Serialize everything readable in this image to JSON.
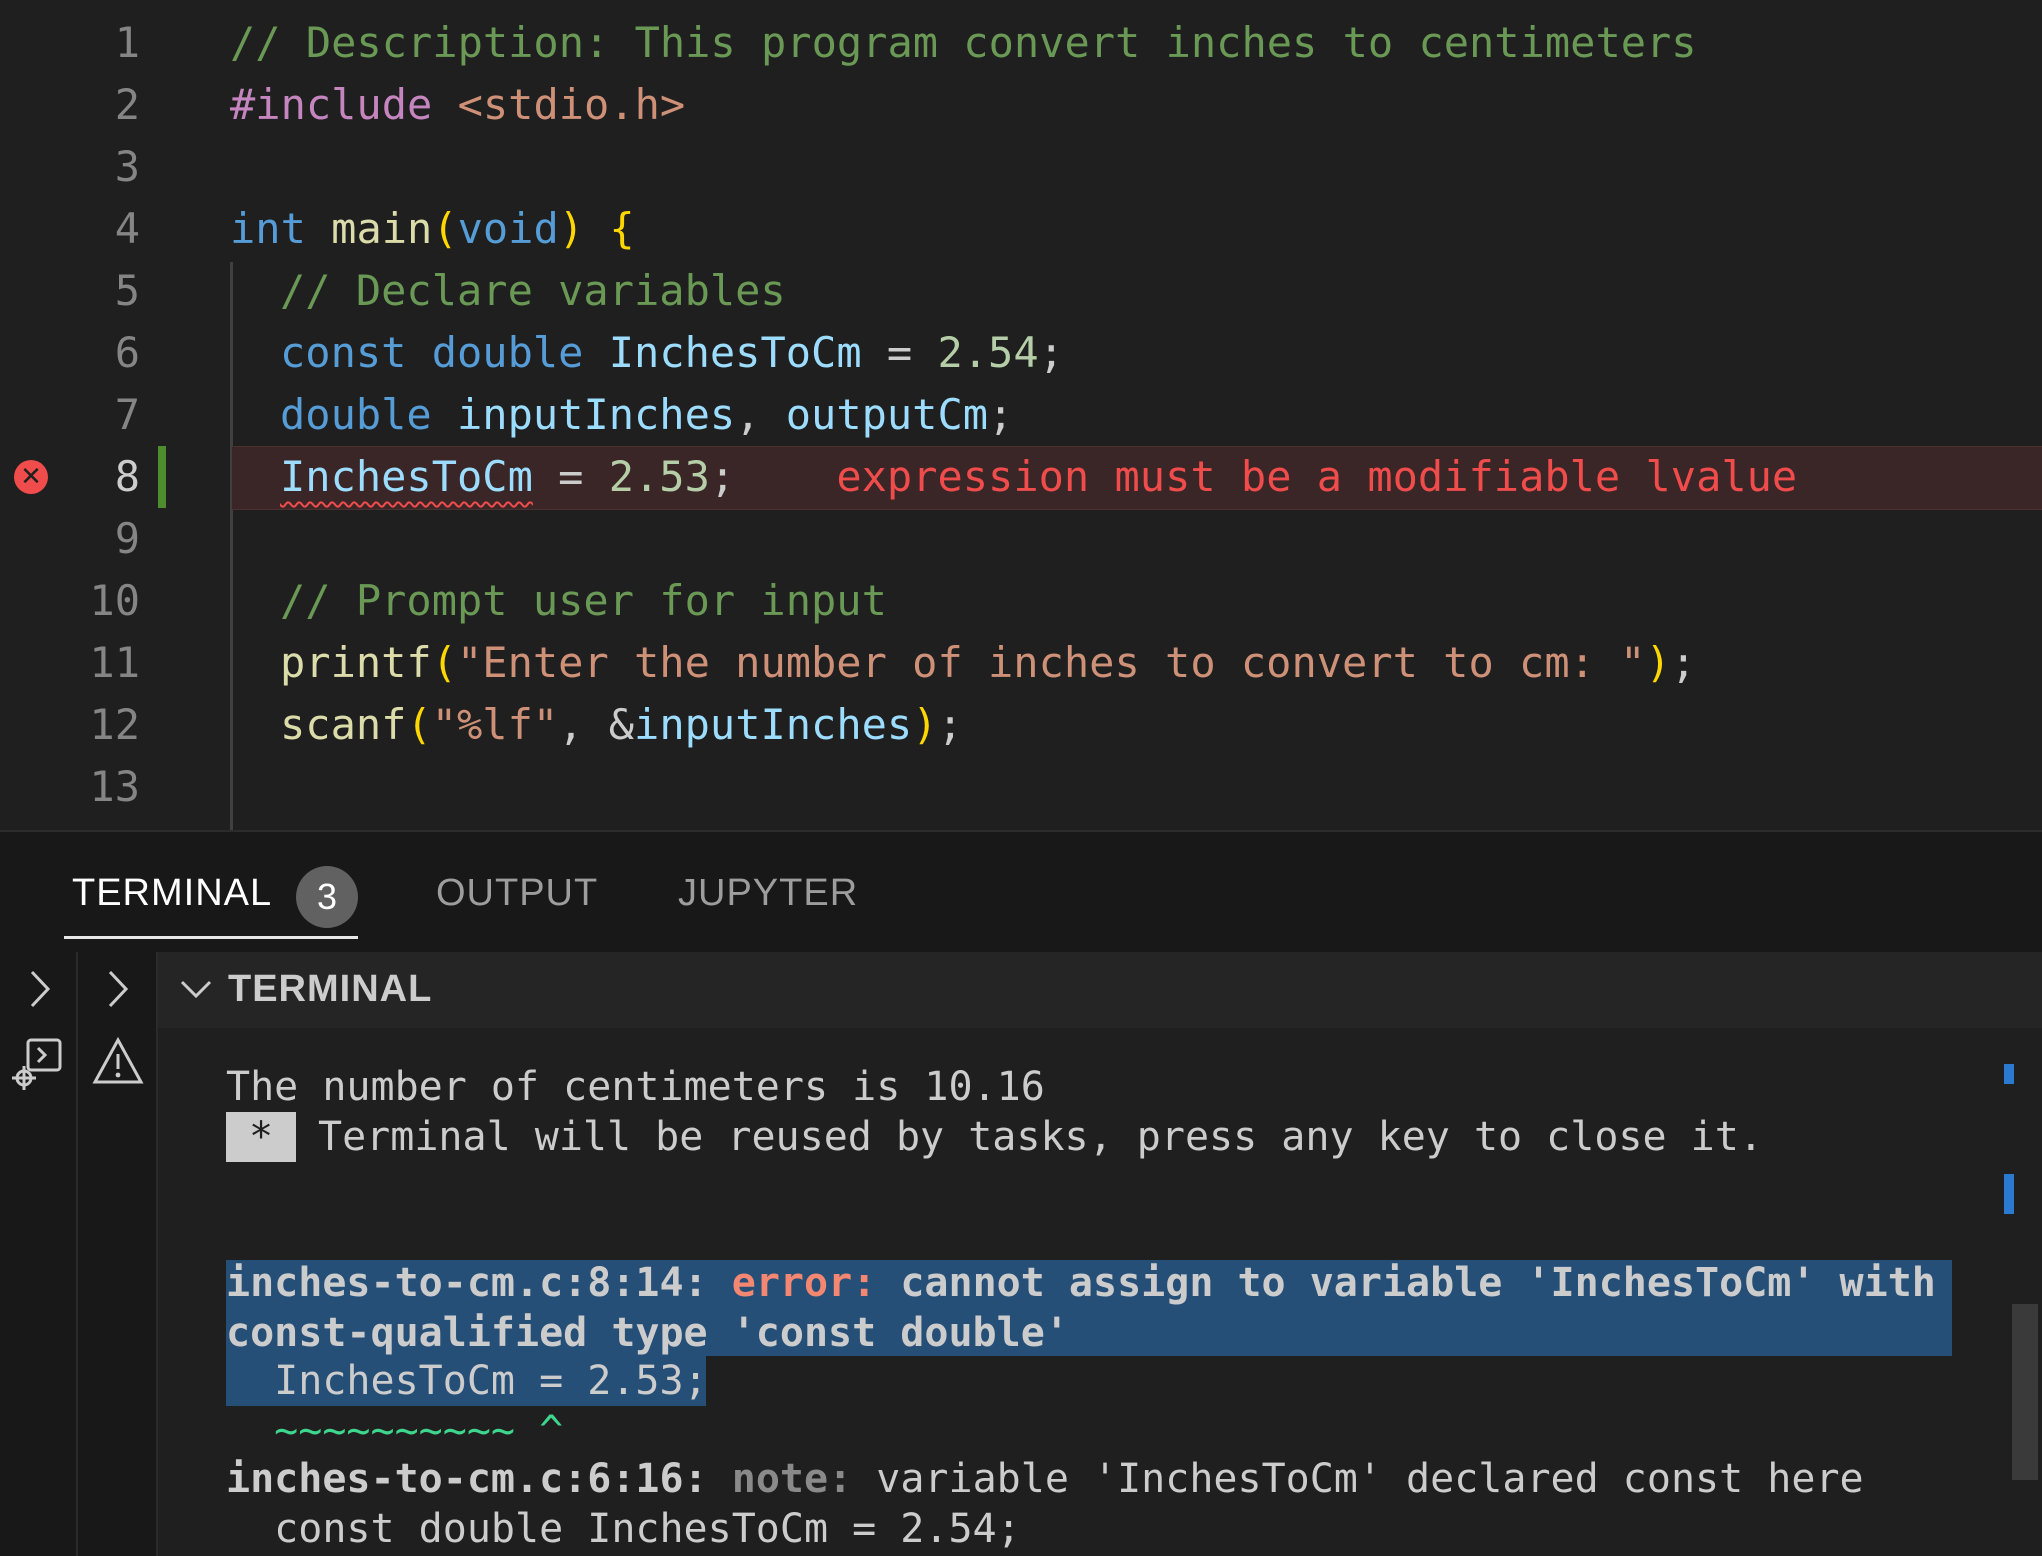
{
  "editor": {
    "lines": [
      {
        "num": "1",
        "text": "// Description: This program convert inches to centimeters"
      },
      {
        "num": "2",
        "directive": "#include",
        "header": "<stdio.h>"
      },
      {
        "num": "3"
      },
      {
        "num": "4",
        "type": "int",
        "func": "main",
        "param": "void",
        "brace": "{"
      },
      {
        "num": "5",
        "text": "// Declare variables"
      },
      {
        "num": "6",
        "kw1": "const",
        "kw2": "double",
        "var": "InchesToCm",
        "op": " = ",
        "val": "2.54",
        "end": ";"
      },
      {
        "num": "7",
        "kw": "double",
        "v1": "inputInches",
        "sep": ", ",
        "v2": "outputCm",
        "end": ";"
      },
      {
        "num": "8",
        "var": "InchesToCm",
        "op": " = ",
        "val": "2.53",
        "end": ";",
        "error": "expression must be a modifiable lvalue"
      },
      {
        "num": "9"
      },
      {
        "num": "10",
        "text": "// Prompt user for input"
      },
      {
        "num": "11",
        "func": "printf",
        "str": "\"Enter the number of inches to convert to cm: \"",
        "end": ";"
      },
      {
        "num": "12",
        "func": "scanf",
        "str": "\"%lf\"",
        "sep": ", ",
        "amp": "&",
        "arg": "inputInches",
        "end": ";"
      },
      {
        "num": "13"
      }
    ]
  },
  "panel": {
    "tabs": [
      {
        "label": "TERMINAL",
        "badge": "3"
      },
      {
        "label": "OUTPUT"
      },
      {
        "label": "JUPYTER"
      }
    ],
    "terminal_title": "TERMINAL"
  },
  "terminal": {
    "line1": "The number of centimeters is 10.16",
    "star": "*",
    "line2": "Terminal will be reused by tasks, press any key to close it.",
    "err_loc": "inches-to-cm.c:8:14:",
    "err_label": "error:",
    "err_msg": "cannot assign to variable 'InchesToCm' with",
    "err_msg2": "const-qualified type 'const double'",
    "err_src": "  InchesToCm = 2.53;",
    "err_mark": "  ~~~~~~~~~~ ^",
    "note_loc": "inches-to-cm.c:6:16:",
    "note_label": "note:",
    "note_msg": "variable 'InchesToCm' declared const here",
    "note_src": "  const double InchesToCm = 2.54;"
  },
  "colors": {
    "background": "#1f1f1f",
    "error": "#f14c4c",
    "selection": "#264f78",
    "comment": "#6a9955",
    "keyword": "#569cd6"
  }
}
